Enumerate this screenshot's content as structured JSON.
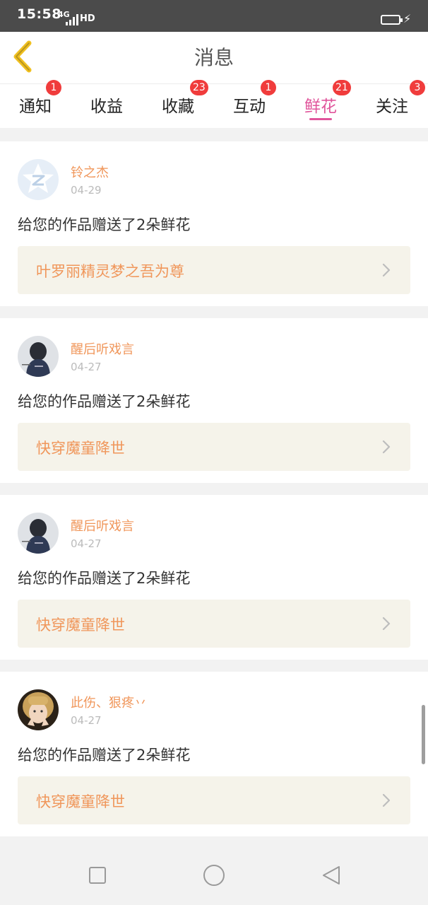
{
  "status": {
    "time": "15:58",
    "network": "4G",
    "hd": "HD",
    "charging_icon": "charging-bolt-icon"
  },
  "header": {
    "title": "消息",
    "back_icon": "back-chevron-icon",
    "accent": "#f0c020"
  },
  "tabs": [
    {
      "label": "通知",
      "badge": "1",
      "active": false
    },
    {
      "label": "收益",
      "badge": "",
      "active": false
    },
    {
      "label": "收藏",
      "badge": "23",
      "active": false
    },
    {
      "label": "互动",
      "badge": "1",
      "active": false
    },
    {
      "label": "鲜花",
      "badge": "21",
      "active": true
    },
    {
      "label": "关注",
      "badge": "3",
      "active": false
    }
  ],
  "colors": {
    "active_tab": "#e0559b",
    "badge": "#f03c3c",
    "username": "#f0965a",
    "work_title": "#f0965a",
    "work_bg": "#f5f3ea"
  },
  "messages": [
    {
      "username": "铃之杰",
      "date": "04-29",
      "text": "给您的作品赠送了2朵鲜花",
      "work": "叶罗丽精灵梦之吾为尊",
      "avatar": "default-avatar-icon"
    },
    {
      "username": "醒后听戏言",
      "date": "04-27",
      "text": "给您的作品赠送了2朵鲜花",
      "work": "快穿魔童降世",
      "avatar": "user-avatar-dark"
    },
    {
      "username": "醒后听戏言",
      "date": "04-27",
      "text": "给您的作品赠送了2朵鲜花",
      "work": "快穿魔童降世",
      "avatar": "user-avatar-dark"
    },
    {
      "username": "此伤、狠疼丷",
      "date": "04-27",
      "text": "给您的作品赠送了2朵鲜花",
      "work": "快穿魔童降世",
      "avatar": "user-avatar-photo"
    }
  ],
  "nav": {
    "recent_icon": "square-icon",
    "home_icon": "circle-icon",
    "back_icon": "triangle-back-icon"
  }
}
